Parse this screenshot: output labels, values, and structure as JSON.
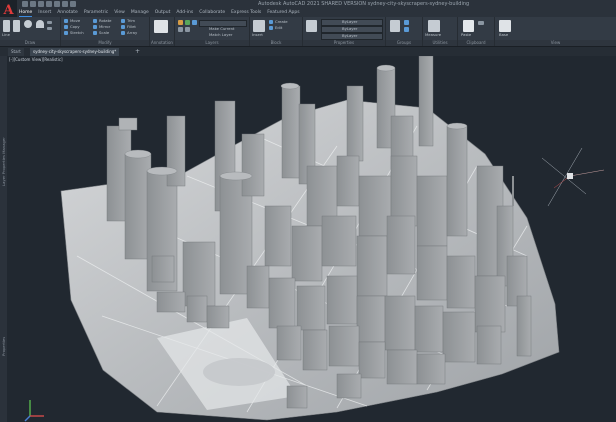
{
  "app": {
    "logo_letter": "A",
    "title": "Autodesk AutoCAD 2021   SHARED VERSION   sydney-city-skyscrapers-sydney-building"
  },
  "menu": {
    "items": [
      "Home",
      "Insert",
      "Annotate",
      "Parametric",
      "View",
      "Manage",
      "Output",
      "Add-ins",
      "Collaborate",
      "Express Tools",
      "Featured Apps"
    ],
    "active_index": 0
  },
  "ribbon": {
    "panels": [
      {
        "name": "Draw",
        "tools": [
          "Line",
          "Polyline",
          "Circle",
          "Arc"
        ]
      },
      {
        "name": "Modify",
        "tools": [
          "Move",
          "Rotate",
          "Trim",
          "Copy",
          "Mirror",
          "Fillet",
          "Stretch",
          "Scale",
          "Array"
        ]
      },
      {
        "name": "Annotation",
        "tools": [
          "Text",
          "Dimension",
          "Leader",
          "Table"
        ]
      },
      {
        "name": "Layers",
        "tools": [
          "Layer Properties",
          "Make Current",
          "Match Layer"
        ]
      },
      {
        "name": "Block",
        "tools": [
          "Insert",
          "Create",
          "Edit",
          "Edit Attributes"
        ]
      },
      {
        "name": "Properties",
        "tools": [
          "Match Properties",
          "ByLayer",
          "ByLayer",
          "ByLayer"
        ]
      },
      {
        "name": "Groups",
        "tools": [
          "Group"
        ]
      },
      {
        "name": "Utilities",
        "tools": [
          "Measure"
        ]
      },
      {
        "name": "Clipboard",
        "tools": [
          "Paste"
        ]
      },
      {
        "name": "View",
        "tools": [
          "Base"
        ]
      }
    ],
    "combo_values": [
      "ByLayer",
      "ByLayer",
      "ByLayer"
    ]
  },
  "tabs": [
    {
      "label": "Start",
      "active": false
    },
    {
      "label": "sydney-city-skyscrapers-sydney-building*",
      "active": true
    }
  ],
  "viewport": {
    "label": "[-][Custom View][Realistic]"
  },
  "sidebar": {
    "label_top": "Layer Properties Manager",
    "label_bottom": "Properties"
  },
  "colors": {
    "background": "#212830",
    "ribbon": "#333b45",
    "accent": "#3c8ce0",
    "logo": "#e03b3b"
  }
}
